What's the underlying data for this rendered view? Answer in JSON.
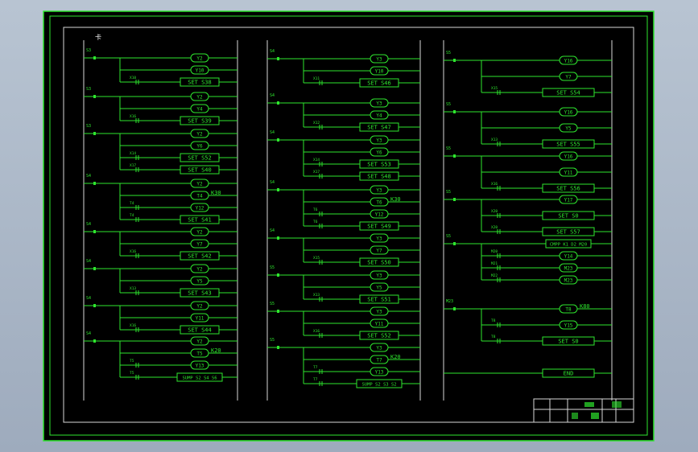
{
  "colors": {
    "background": "#000000",
    "wire": "#2ee62e",
    "rail": "#d8d8d8",
    "viewport": "#aab7c7"
  },
  "columns": [
    {
      "rungs": [
        {
          "contact": "S3",
          "outputs": [
            {
              "t": "coil",
              "text": "Y2"
            },
            {
              "t": "coil",
              "text": "Y10"
            },
            {
              "t": "box",
              "text": "SET S38",
              "c": "X10"
            }
          ]
        },
        {
          "contact": "S3",
          "outputs": [
            {
              "t": "coil",
              "text": "Y2"
            },
            {
              "t": "coil",
              "text": "Y4"
            },
            {
              "t": "box",
              "text": "SET S39",
              "c": "X16"
            }
          ]
        },
        {
          "contact": "S3",
          "outputs": [
            {
              "t": "coil",
              "text": "Y2"
            },
            {
              "t": "coil",
              "text": "Y6"
            },
            {
              "t": "box",
              "text": "SET S52",
              "c": "X14"
            },
            {
              "t": "box",
              "text": "SET S40",
              "c": "X17"
            }
          ]
        },
        {
          "contact": "S4",
          "outputs": [
            {
              "t": "coil",
              "text": "Y2"
            },
            {
              "t": "coil",
              "text": "T4",
              "k": "K30"
            },
            {
              "t": "coil",
              "text": "Y12",
              "c": "T4"
            },
            {
              "t": "box",
              "text": "SET S41",
              "c": "T4"
            }
          ]
        },
        {
          "contact": "S4",
          "outputs": [
            {
              "t": "coil",
              "text": "Y2"
            },
            {
              "t": "coil",
              "text": "Y7"
            },
            {
              "t": "box",
              "text": "SET S42",
              "c": "X16"
            }
          ]
        },
        {
          "contact": "S4",
          "outputs": [
            {
              "t": "coil",
              "text": "Y2"
            },
            {
              "t": "coil",
              "text": "Y5"
            },
            {
              "t": "box",
              "text": "SET S43",
              "c": "X13"
            }
          ]
        },
        {
          "contact": "S4",
          "outputs": [
            {
              "t": "coil",
              "text": "Y2"
            },
            {
              "t": "coil",
              "text": "Y11"
            },
            {
              "t": "box",
              "text": "SET S44",
              "c": "X16"
            }
          ]
        },
        {
          "contact": "S4",
          "outputs": [
            {
              "t": "coil",
              "text": "Y2"
            },
            {
              "t": "coil",
              "text": "T5",
              "k": "K20"
            },
            {
              "t": "coil",
              "text": "Y13",
              "c": "T5"
            },
            {
              "t": "box",
              "text": "SUMP S2 S4 S6",
              "c": "T5"
            }
          ]
        }
      ]
    },
    {
      "rungs": [
        {
          "contact": "S4",
          "outputs": [
            {
              "t": "coil",
              "text": "Y3"
            },
            {
              "t": "coil",
              "text": "Y10"
            },
            {
              "t": "box",
              "text": "SET S46",
              "c": "X11"
            }
          ]
        },
        {
          "contact": "S4",
          "outputs": [
            {
              "t": "coil",
              "text": "Y3"
            },
            {
              "t": "coil",
              "text": "Y4"
            },
            {
              "t": "box",
              "text": "SET S47",
              "c": "X12"
            }
          ]
        },
        {
          "contact": "S4",
          "outputs": [
            {
              "t": "coil",
              "text": "Y3"
            },
            {
              "t": "coil",
              "text": "Y6"
            },
            {
              "t": "box",
              "text": "SET S53",
              "c": "X14"
            },
            {
              "t": "box",
              "text": "SET S48",
              "c": "X17"
            }
          ]
        },
        {
          "contact": "S4",
          "outputs": [
            {
              "t": "coil",
              "text": "Y3"
            },
            {
              "t": "coil",
              "text": "T6",
              "k": "K30"
            },
            {
              "t": "coil",
              "text": "Y12",
              "c": "T6"
            },
            {
              "t": "box",
              "text": "SET S49",
              "c": "T6"
            }
          ]
        },
        {
          "contact": "S4",
          "outputs": [
            {
              "t": "coil",
              "text": "Y3"
            },
            {
              "t": "coil",
              "text": "Y7"
            },
            {
              "t": "box",
              "text": "SET S50",
              "c": "X15"
            }
          ]
        },
        {
          "contact": "S5",
          "outputs": [
            {
              "t": "coil",
              "text": "Y3"
            },
            {
              "t": "coil",
              "text": "Y5"
            },
            {
              "t": "box",
              "text": "SET S51",
              "c": "X13"
            }
          ]
        },
        {
          "contact": "S5",
          "outputs": [
            {
              "t": "coil",
              "text": "Y3"
            },
            {
              "t": "coil",
              "text": "Y11"
            },
            {
              "t": "box",
              "text": "SET S52",
              "c": "X16"
            }
          ]
        },
        {
          "contact": "S5",
          "outputs": [
            {
              "t": "coil",
              "text": "Y3"
            },
            {
              "t": "coil",
              "text": "T7",
              "k": "K20"
            },
            {
              "t": "coil",
              "text": "Y13",
              "c": "T7"
            },
            {
              "t": "box",
              "text": "SUMP S2 S3 S2",
              "c": "T7"
            }
          ]
        }
      ]
    },
    {
      "rungs": [
        {
          "contact": "S5",
          "outputs": [
            {
              "t": "coil",
              "text": "Y16"
            },
            {
              "t": "coil",
              "text": "Y7"
            },
            {
              "t": "box",
              "text": "SET S54",
              "c": "X15"
            }
          ]
        },
        {
          "contact": "S5",
          "outputs": [
            {
              "t": "coil",
              "text": "Y16"
            },
            {
              "t": "coil",
              "text": "Y5"
            },
            {
              "t": "box",
              "text": "SET S55",
              "c": "X13"
            }
          ]
        },
        {
          "contact": "S5",
          "outputs": [
            {
              "t": "coil",
              "text": "Y16"
            },
            {
              "t": "coil",
              "text": "Y11"
            },
            {
              "t": "box",
              "text": "SET S56",
              "c": "X16"
            }
          ]
        },
        {
          "contact": "S5",
          "outputs": [
            {
              "t": "coil",
              "text": "Y17"
            },
            {
              "t": "box",
              "text": "SET S0",
              "c": "X20"
            },
            {
              "t": "box",
              "text": "SET S57",
              "c": "X20"
            }
          ]
        },
        {
          "contact": "S5",
          "outputs": [
            {
              "t": "box",
              "text": "CMPP K1 D2 M20"
            },
            {
              "t": "coil",
              "text": "Y14",
              "c": "M20"
            },
            {
              "t": "coil",
              "text": "M23",
              "c": "M21"
            },
            {
              "t": "coil",
              "text": "M23",
              "c": "M22"
            }
          ]
        },
        {
          "contact": "M23",
          "outputs": [
            {
              "t": "coil",
              "text": "T8",
              "k": "K80"
            },
            {
              "t": "coil",
              "text": "Y15",
              "c": "T8"
            },
            {
              "t": "box",
              "text": "SET S0",
              "c": "T8"
            }
          ]
        },
        {
          "contact": "",
          "outputs": [
            {
              "t": "box",
              "text": "END"
            }
          ]
        }
      ]
    }
  ],
  "corner_mark": "卡"
}
